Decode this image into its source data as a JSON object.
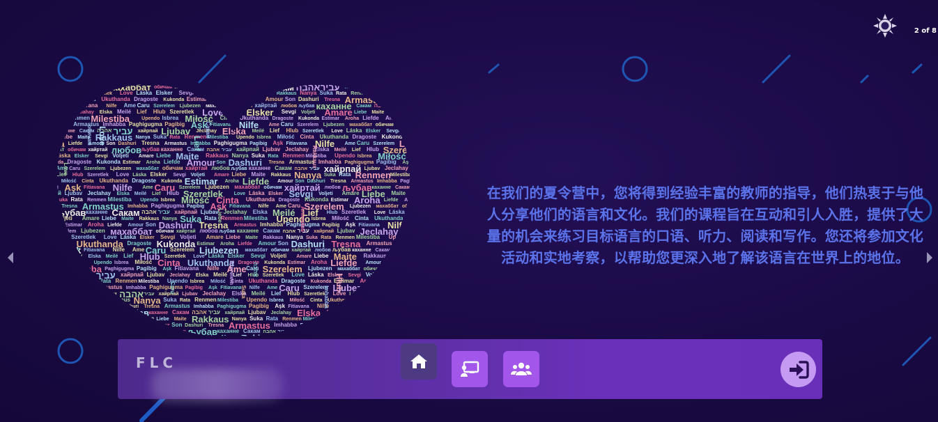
{
  "window": {
    "slide_counter": "2 of 8"
  },
  "icons": {
    "theme": "sun-icon",
    "prev": "chevron-left-icon",
    "next": "chevron-right-icon",
    "home": "home-icon",
    "present": "presentation-icon",
    "group": "users-icon",
    "login": "sign-in-icon"
  },
  "main": {
    "description": "在我们的夏令营中，您将得到经验丰富的教师的指导，他们热衷于与他人分享他们的语言和文化。我们的课程旨在互动和引人入胜，提供了大量的机会来练习目标语言的口语、听力、阅读和写作。您还将参加文化活动和实地考察，以帮助您更深入地了解该语言在世界上的地位。"
  },
  "word_cloud": {
    "words": [
      "Love",
      "Láska",
      "Elsker",
      "Sevgi",
      "Voljeti",
      "Amare",
      "Liebe",
      "Maite",
      "Rakkaus",
      "Nanya",
      "Suka",
      "Rata",
      "Renmen",
      "Milestiba",
      "Upendo",
      "Isbrea",
      "Miłość",
      "Cinta",
      "Ukuthanda",
      "Dragoste",
      "Kukonda",
      "Estimar",
      "Aroha",
      "Liefde",
      "Amour",
      "Son",
      "Dashuri",
      "Tresna",
      "Armastus",
      "Imhabba",
      "Paghigugma",
      "Pagibig",
      "Aşk",
      "Fitiavana",
      "Nilfe",
      "Ame",
      "Caru",
      "Szerelem",
      "Ljubezen",
      "махаббат",
      "обичам",
      "хайртай",
      "любов",
      "љубав",
      "каханне",
      "Сакам",
      "אהבה",
      "עביר",
      "хайрпай",
      "Ljubav",
      "Jeclahay",
      "Elska",
      "Meilé",
      "Lief",
      "Hlub",
      "Szeretlek"
    ],
    "colors": [
      "#e7e1a6",
      "#a6d4a0",
      "#f0a4b6",
      "#9fc2ea",
      "#c7a6ea",
      "#e6b78a",
      "#f0f0e8",
      "#7fd1c8",
      "#e86f9b",
      "#b4e0f4"
    ]
  },
  "footer": {
    "brand": "FLC"
  },
  "colors": {
    "background": "#1a0a45",
    "text_accent": "#5b73ea",
    "button": "#a357ea",
    "button_dark": "#4e3a82",
    "login_button": "#c49af2"
  }
}
